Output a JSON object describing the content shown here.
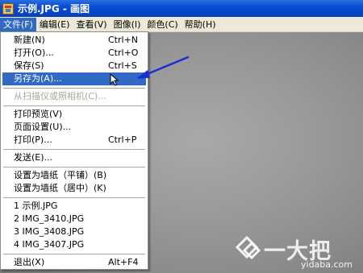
{
  "window": {
    "title": "示例.JPG - 画图"
  },
  "menubar": [
    {
      "label": "文件(F)",
      "active": true
    },
    {
      "label": "编辑(E)"
    },
    {
      "label": "查看(V)"
    },
    {
      "label": "图像(I)"
    },
    {
      "label": "颜色(C)"
    },
    {
      "label": "帮助(H)"
    }
  ],
  "file_menu": {
    "new": {
      "label": "新建(N)",
      "shortcut": "Ctrl+N"
    },
    "open": {
      "label": "打开(O)...",
      "shortcut": "Ctrl+O"
    },
    "save": {
      "label": "保存(S)",
      "shortcut": "Ctrl+S"
    },
    "save_as": {
      "label": "另存为(A)...",
      "highlighted": true
    },
    "scan": {
      "label": "从扫描仪或照相机(C)...",
      "disabled": true
    },
    "print_preview": {
      "label": "打印预览(V)"
    },
    "page_setup": {
      "label": "页面设置(U)..."
    },
    "print": {
      "label": "打印(P)...",
      "shortcut": "Ctrl+P"
    },
    "send": {
      "label": "发送(E)..."
    },
    "wallpaper_tiled": {
      "label": "设置为墙纸（平铺）(B)"
    },
    "wallpaper_center": {
      "label": "设置为墙纸（居中）(K)"
    },
    "recent": [
      {
        "label": "1 示例.JPG"
      },
      {
        "label": "2 IMG_3410.JPG"
      },
      {
        "label": "3 IMG_3408.JPG"
      },
      {
        "label": "4 IMG_3407.JPG"
      }
    ],
    "exit": {
      "label": "退出(X)",
      "shortcut": "Alt+F4"
    }
  },
  "watermark": {
    "brand": "一大把",
    "url": "yidaba.com"
  },
  "colors": {
    "highlight": "#316ac5",
    "annotation_arrow": "#1a2fd0",
    "titlebar": "#0a4fd6"
  }
}
